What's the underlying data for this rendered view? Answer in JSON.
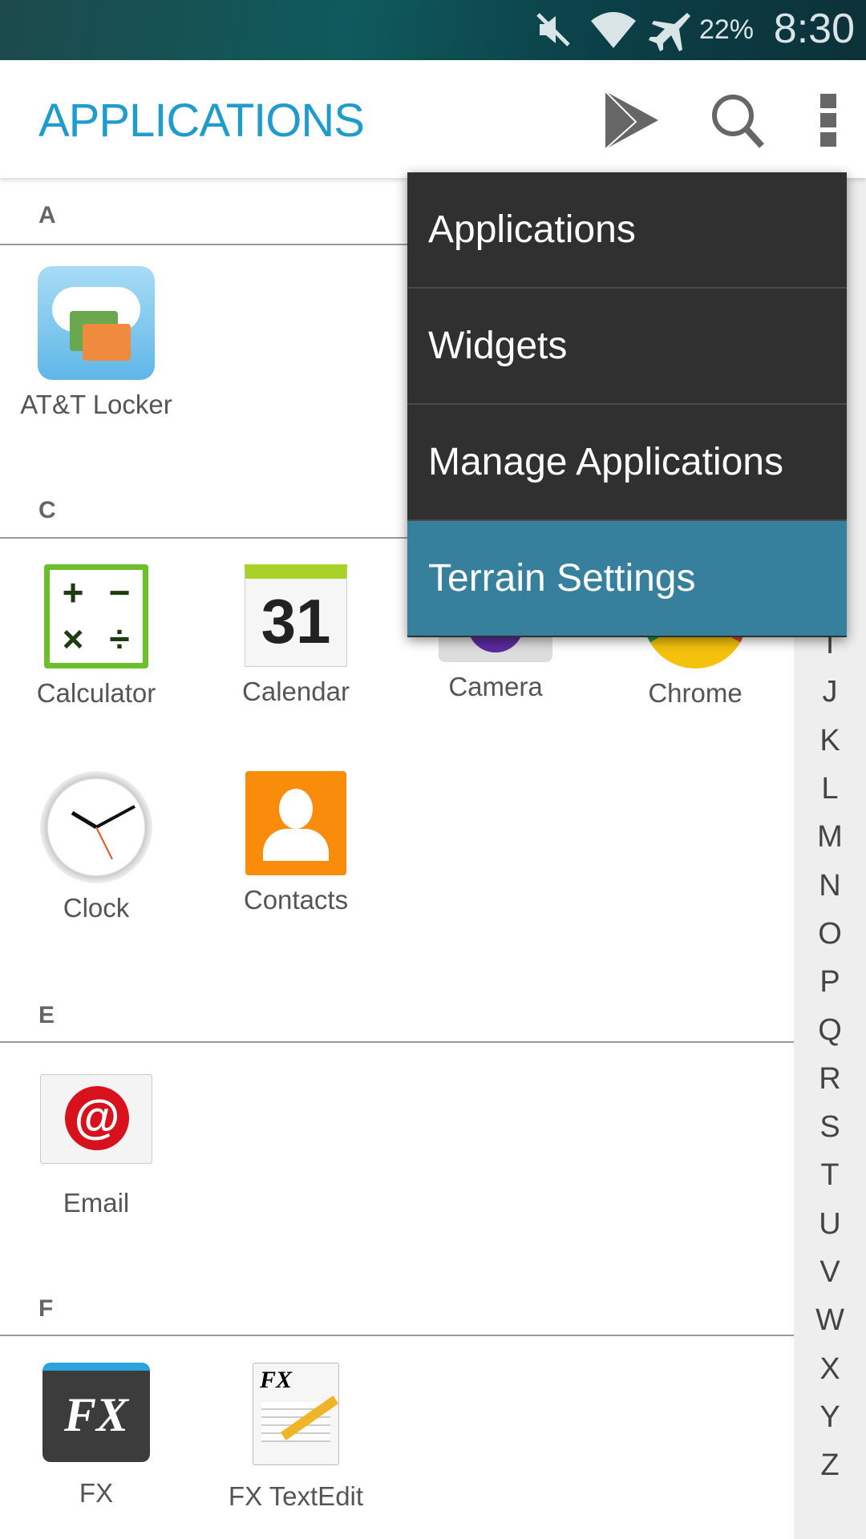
{
  "status_bar": {
    "battery": "22%",
    "time": "8:30",
    "icons": [
      "mute-icon",
      "wifi-icon",
      "airplane-icon"
    ]
  },
  "header": {
    "title": "APPLICATIONS",
    "actions": [
      "play-store-icon",
      "search-icon",
      "overflow-menu-icon"
    ],
    "title_color": "#1f9ccb"
  },
  "menu": {
    "items": [
      {
        "label": "Applications"
      },
      {
        "label": "Widgets"
      },
      {
        "label": "Manage Applications"
      },
      {
        "label": "Terrain Settings",
        "selected": true
      }
    ],
    "highlight_color": "#367f9d"
  },
  "sections": [
    {
      "letter": "A",
      "apps": [
        {
          "label": "AT&T Locker"
        }
      ]
    },
    {
      "letter": "C",
      "apps": [
        {
          "label": "Calculator"
        },
        {
          "label": "Calendar",
          "icon_text": "31"
        },
        {
          "label": "Camera"
        },
        {
          "label": "Chrome"
        },
        {
          "label": "Clock"
        },
        {
          "label": "Contacts"
        }
      ]
    },
    {
      "letter": "E",
      "apps": [
        {
          "label": "Email"
        }
      ]
    },
    {
      "letter": "F",
      "apps": [
        {
          "label": "FX"
        },
        {
          "label": "FX TextEdit"
        }
      ]
    }
  ],
  "index": [
    "I",
    "J",
    "K",
    "L",
    "M",
    "N",
    "O",
    "P",
    "Q",
    "R",
    "S",
    "T",
    "U",
    "V",
    "W",
    "X",
    "Y",
    "Z"
  ]
}
